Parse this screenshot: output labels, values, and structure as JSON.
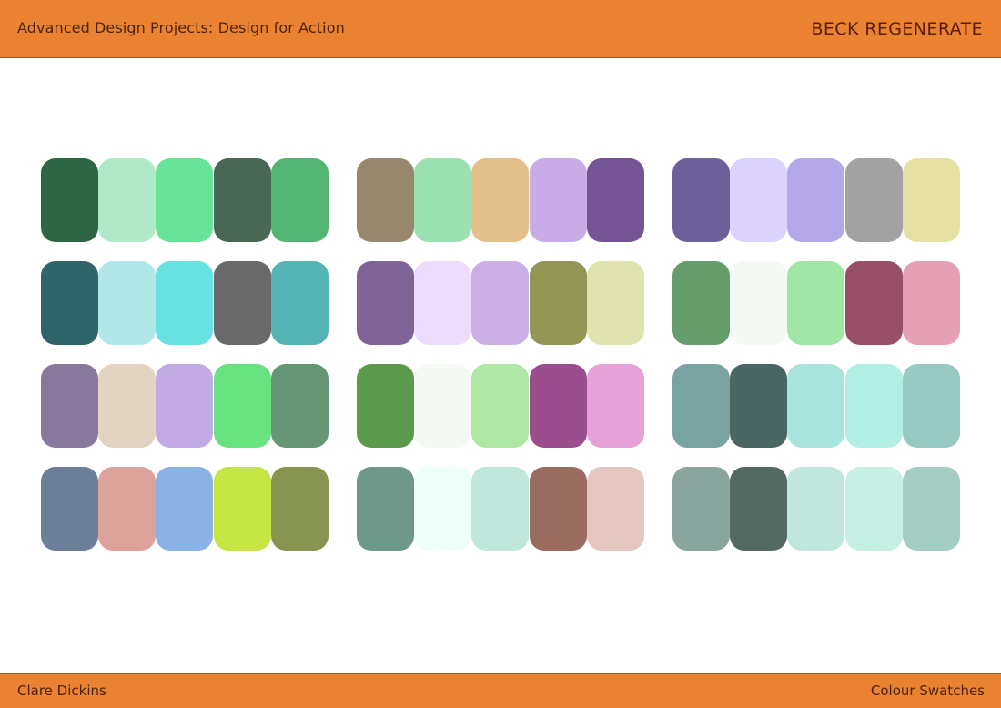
{
  "header": {
    "left_text": "Advanced Design Projects: Design for Action",
    "right_text": "BECK REGENERATE",
    "background": "#EA8232"
  },
  "footer": {
    "left_text": "Clare Dickins",
    "right_text": "Colour Swatches",
    "background": "#EA8232"
  },
  "palette_groups": [
    {
      "rows": [
        [
          "#2D6645",
          "#B0E9C8",
          "#66E396",
          "#4A6655",
          "#53B474"
        ],
        [
          "#2F6568",
          "#B2E7E7",
          "#67E1E2",
          "#696969",
          "#54B3B4"
        ],
        [
          "#88799C",
          "#E2D4C3",
          "#C2ABE4",
          "#66E37E",
          "#679676"
        ],
        [
          "#6C7E99",
          "#DEA29C",
          "#8AB2E5",
          "#C5E542",
          "#889451"
        ]
      ]
    },
    {
      "rows": [
        [
          "#97876D",
          "#9BE0B3",
          "#E3BF8C",
          "#C9ABE7",
          "#745494"
        ],
        [
          "#7E6497",
          "#EEDCFE",
          "#CAB0E6",
          "#939654",
          "#E0E3AE"
        ],
        [
          "#5B9A4C",
          "#F4F9F4",
          "#AFE7A4",
          "#9A4E8D",
          "#E5A1D8"
        ],
        [
          "#6E9889",
          "#EEFEF9",
          "#BFE7DB",
          "#996C5F",
          "#E6C6C1"
        ]
      ]
    },
    {
      "rows": [
        [
          "#6D5F9A",
          "#DCD2FE",
          "#B4A8E8",
          "#A2A2A2",
          "#E5E0A4"
        ],
        [
          "#659C6B",
          "#F4F9F4",
          "#A0E6A7",
          "#994E68",
          "#E6A0B6"
        ],
        [
          "#78A3A1",
          "#4A6663",
          "#A8E3DC",
          "#B1EEE4",
          "#96CAC3"
        ],
        [
          "#8AA59E",
          "#546962",
          "#BFE7DE",
          "#C7F0E5",
          "#A4CDC3"
        ]
      ]
    }
  ]
}
